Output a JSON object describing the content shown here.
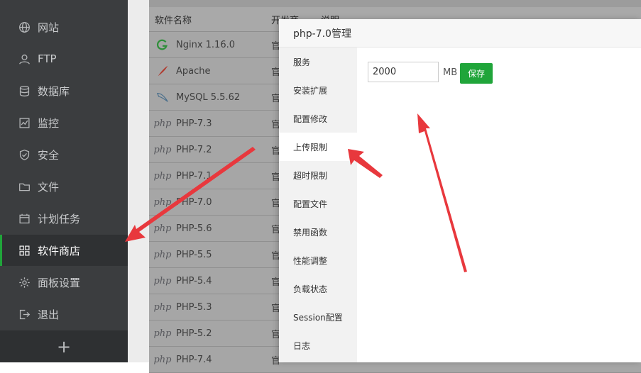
{
  "sidebar": {
    "items": [
      {
        "label": "网站",
        "icon": "globe-icon"
      },
      {
        "label": "FTP",
        "icon": "ftp-user-icon"
      },
      {
        "label": "数据库",
        "icon": "database-icon"
      },
      {
        "label": "监控",
        "icon": "monitor-icon"
      },
      {
        "label": "安全",
        "icon": "shield-icon"
      },
      {
        "label": "文件",
        "icon": "folder-icon"
      },
      {
        "label": "计划任务",
        "icon": "calendar-icon"
      },
      {
        "label": "软件商店",
        "icon": "app-grid-icon",
        "active": true
      },
      {
        "label": "面板设置",
        "icon": "gear-icon"
      },
      {
        "label": "退出",
        "icon": "logout-icon"
      }
    ],
    "add_label": "+"
  },
  "table": {
    "headers": [
      "软件名称",
      "开发商",
      "说明"
    ],
    "rows": [
      {
        "name": "Nginx 1.16.0",
        "developer": "官",
        "logo": "nginx-logo-icon"
      },
      {
        "name": "Apache",
        "developer": "官",
        "logo": "apache-feather-icon"
      },
      {
        "name": "MySQL 5.5.62",
        "developer": "官",
        "logo": "mysql-dolphin-icon"
      },
      {
        "name": "PHP-7.3",
        "developer": "官",
        "logo": "php-logo-icon"
      },
      {
        "name": "PHP-7.2",
        "developer": "官",
        "logo": "php-logo-icon"
      },
      {
        "name": "PHP-7.1",
        "developer": "官",
        "logo": "php-logo-icon"
      },
      {
        "name": "PHP-7.0",
        "developer": "官",
        "logo": "php-logo-icon"
      },
      {
        "name": "PHP-5.6",
        "developer": "官",
        "logo": "php-logo-icon"
      },
      {
        "name": "PHP-5.5",
        "developer": "官",
        "logo": "php-logo-icon"
      },
      {
        "name": "PHP-5.4",
        "developer": "官",
        "logo": "php-logo-icon"
      },
      {
        "name": "PHP-5.3",
        "developer": "官",
        "logo": "php-logo-icon"
      },
      {
        "name": "PHP-5.2",
        "developer": "官",
        "logo": "php-logo-icon"
      },
      {
        "name": "PHP-7.4",
        "developer": "官",
        "logo": "php-logo-icon"
      }
    ],
    "php_logo_text": "php"
  },
  "modal": {
    "title": "php-7.0管理",
    "menu": [
      "服务",
      "安装扩展",
      "配置修改",
      "上传限制",
      "超时限制",
      "配置文件",
      "禁用函数",
      "性能调整",
      "负载状态",
      "Session配置",
      "日志"
    ],
    "active_menu": "上传限制",
    "upload_limit": {
      "value": "2000",
      "unit": "MB",
      "save_label": "保存"
    }
  },
  "colors": {
    "sidebar_bg": "#3b3d3f",
    "accent_green": "#20a53a",
    "arrow_red": "#e8383d"
  }
}
